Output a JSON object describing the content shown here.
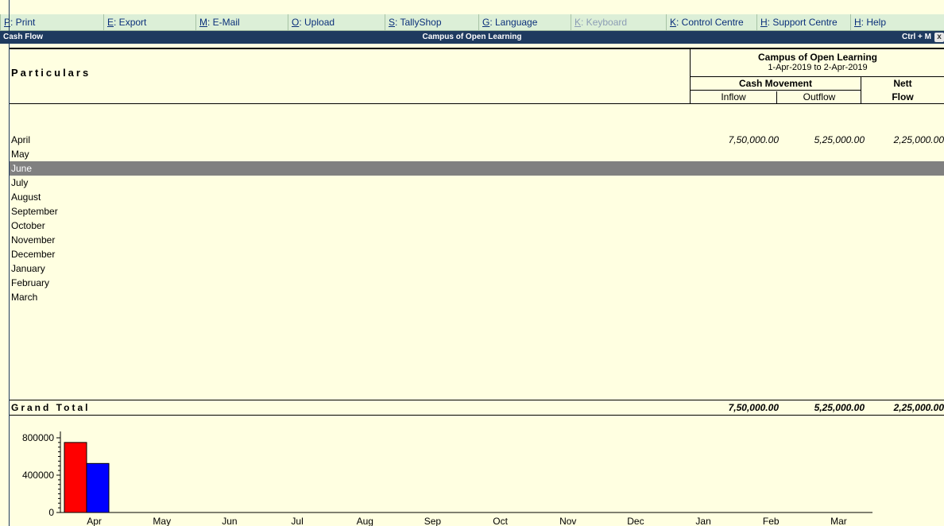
{
  "menu": {
    "items": [
      {
        "key": "P",
        "label": ": Print",
        "disabled": false
      },
      {
        "key": "E",
        "label": ": Export",
        "disabled": false
      },
      {
        "key": "M",
        "label": ": E-Mail",
        "disabled": false
      },
      {
        "key": "O",
        "label": ": Upload",
        "disabled": false
      },
      {
        "key": "S",
        "label": ": TallyShop",
        "disabled": false
      },
      {
        "key": "G",
        "label": ": Language",
        "disabled": false
      },
      {
        "key": "K",
        "label": ": Keyboard",
        "disabled": true
      },
      {
        "key": "K",
        "label": ": Control Centre",
        "disabled": false
      },
      {
        "key": "H",
        "label": ": Support Centre",
        "disabled": false
      },
      {
        "key": "H",
        "label": ": Help",
        "disabled": false
      }
    ]
  },
  "titlebar": {
    "left": "Cash Flow",
    "center": "Campus of Open Learning",
    "right": "Ctrl + M",
    "close_glyph": "x"
  },
  "header": {
    "particulars": "Particulars",
    "company": "Campus of Open Learning",
    "period": "1-Apr-2019 to 2-Apr-2019",
    "cash_movement": "Cash Movement",
    "inflow": "Inflow",
    "outflow": "Outflow",
    "nett": "Nett",
    "flow": "Flow"
  },
  "rows": [
    {
      "name": "April",
      "inflow": "7,50,000.00",
      "outflow": "5,25,000.00",
      "nett": "2,25,000.00",
      "selected": false
    },
    {
      "name": "May",
      "inflow": "",
      "outflow": "",
      "nett": "",
      "selected": false
    },
    {
      "name": "June",
      "inflow": "",
      "outflow": "",
      "nett": "",
      "selected": true
    },
    {
      "name": "July",
      "inflow": "",
      "outflow": "",
      "nett": "",
      "selected": false
    },
    {
      "name": "August",
      "inflow": "",
      "outflow": "",
      "nett": "",
      "selected": false
    },
    {
      "name": "September",
      "inflow": "",
      "outflow": "",
      "nett": "",
      "selected": false
    },
    {
      "name": "October",
      "inflow": "",
      "outflow": "",
      "nett": "",
      "selected": false
    },
    {
      "name": "November",
      "inflow": "",
      "outflow": "",
      "nett": "",
      "selected": false
    },
    {
      "name": "December",
      "inflow": "",
      "outflow": "",
      "nett": "",
      "selected": false
    },
    {
      "name": "January",
      "inflow": "",
      "outflow": "",
      "nett": "",
      "selected": false
    },
    {
      "name": "February",
      "inflow": "",
      "outflow": "",
      "nett": "",
      "selected": false
    },
    {
      "name": "March",
      "inflow": "",
      "outflow": "",
      "nett": "",
      "selected": false
    }
  ],
  "grand_total": {
    "label": "Grand Total",
    "inflow": "7,50,000.00",
    "outflow": "5,25,000.00",
    "nett": "2,25,000.00"
  },
  "colors": {
    "inflow": "#ff0000",
    "outflow": "#0000ff",
    "selected_row": "#808080",
    "title_bg": "#1e3a5f",
    "menu_bg": "#dcefd7",
    "page_bg": "#ffffe1"
  },
  "chart_data": {
    "type": "bar",
    "categories": [
      "Apr",
      "May",
      "Jun",
      "Jul",
      "Aug",
      "Sep",
      "Oct",
      "Nov",
      "Dec",
      "Jan",
      "Feb",
      "Mar"
    ],
    "series": [
      {
        "values": [
          750000,
          0,
          0,
          0,
          0,
          0,
          0,
          0,
          0,
          0,
          0,
          0
        ],
        "color": "#ff0000"
      },
      {
        "values": [
          525000,
          0,
          0,
          0,
          0,
          0,
          0,
          0,
          0,
          0,
          0,
          0
        ],
        "color": "#0000ff"
      }
    ],
    "yticks": [
      0,
      400000,
      800000
    ],
    "ylim": [
      0,
      800000
    ]
  }
}
